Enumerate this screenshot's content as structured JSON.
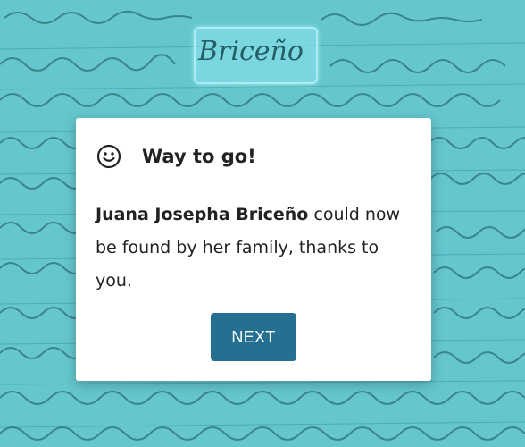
{
  "background": {
    "image_label": "handwritten-record-background",
    "highlighted_word": "Briceño"
  },
  "modal": {
    "icon": "smiley-icon",
    "title": "Way to go!",
    "name": "Juana Josepha Briceño",
    "message_after_name": " could now be found by her family, thanks to you.",
    "next_label": "NEXT"
  },
  "colors": {
    "background_tint": "#65c6ce",
    "button": "#256f90",
    "highlight_border": "#a8eef3"
  }
}
